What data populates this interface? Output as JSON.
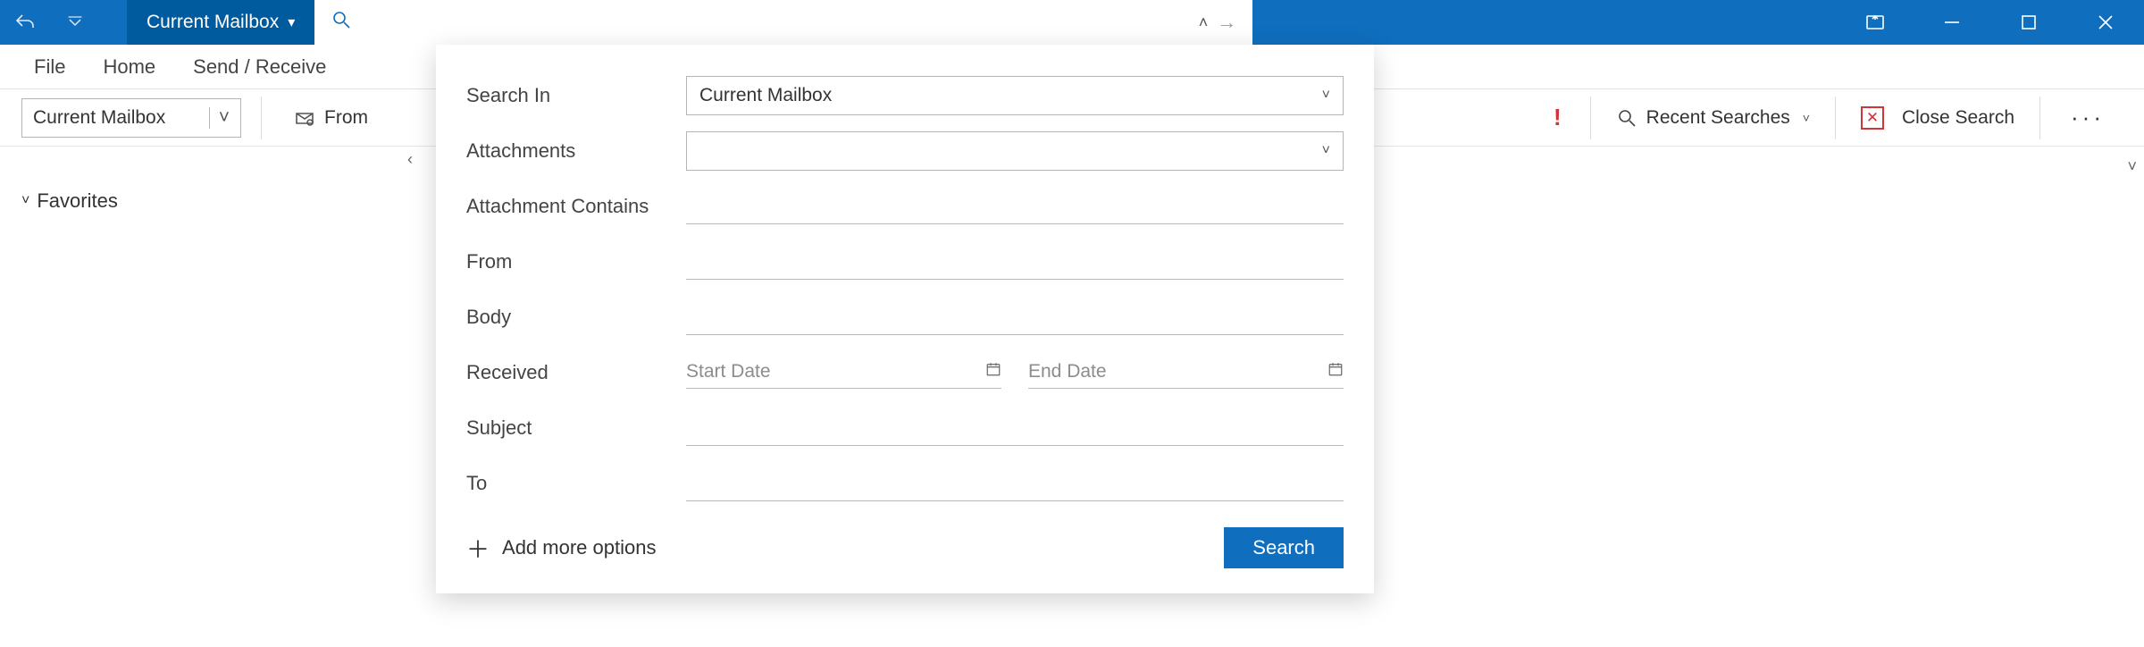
{
  "title_bar": {
    "scope_chip": "Current Mailbox"
  },
  "search_box": {
    "placeholder": ""
  },
  "ribbon_tabs": {
    "file": "File",
    "home": "Home",
    "send_receive": "Send / Receive"
  },
  "ribbon": {
    "scope_select": "Current Mailbox",
    "from": "From",
    "recent_searches": "Recent Searches",
    "close_search": "Close Search"
  },
  "sidebar": {
    "favorites": "Favorites"
  },
  "adv": {
    "labels": {
      "search_in": "Search In",
      "attachments": "Attachments",
      "attachment_contains": "Attachment Contains",
      "from": "From",
      "body": "Body",
      "received": "Received",
      "subject": "Subject",
      "to": "To"
    },
    "search_in_value": "Current Mailbox",
    "attachments_value": "",
    "start_date_placeholder": "Start Date",
    "end_date_placeholder": "End Date",
    "add_more": "Add more options",
    "search_button": "Search"
  }
}
